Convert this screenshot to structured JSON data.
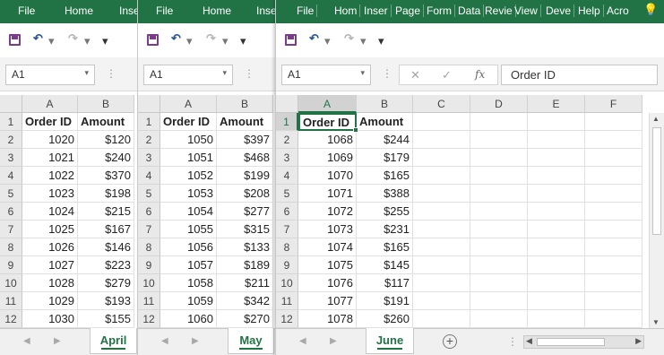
{
  "ribbon_common": [
    "File",
    "Home",
    "Inse"
  ],
  "ribbon_full": [
    "File",
    "Hom",
    "Inser",
    "Page",
    "Form",
    "Data",
    "Revie",
    "View",
    "Deve",
    "Help",
    "Acro"
  ],
  "icons": {
    "save": "save-icon",
    "undo": "undo-icon",
    "redo": "redo-icon",
    "customize": "customize-qat-icon",
    "lightbulb": "lightbulb-icon"
  },
  "accent_color": "#217346",
  "windows": [
    {
      "sheet_name": "April",
      "name_box": "A1",
      "headers": [
        "Order ID",
        "Amount"
      ],
      "rows": [
        [
          "1020",
          "$120"
        ],
        [
          "1021",
          "$240"
        ],
        [
          "1022",
          "$370"
        ],
        [
          "1023",
          "$198"
        ],
        [
          "1024",
          "$215"
        ],
        [
          "1025",
          "$167"
        ],
        [
          "1026",
          "$146"
        ],
        [
          "1027",
          "$223"
        ],
        [
          "1028",
          "$279"
        ],
        [
          "1029",
          "$193"
        ],
        [
          "1030",
          "$155"
        ]
      ]
    },
    {
      "sheet_name": "May",
      "name_box": "A1",
      "headers": [
        "Order ID",
        "Amount"
      ],
      "rows": [
        [
          "1050",
          "$397"
        ],
        [
          "1051",
          "$468"
        ],
        [
          "1052",
          "$199"
        ],
        [
          "1053",
          "$208"
        ],
        [
          "1054",
          "$277"
        ],
        [
          "1055",
          "$315"
        ],
        [
          "1056",
          "$133"
        ],
        [
          "1057",
          "$189"
        ],
        [
          "1058",
          "$211"
        ],
        [
          "1059",
          "$342"
        ],
        [
          "1060",
          "$270"
        ]
      ]
    },
    {
      "sheet_name": "June",
      "name_box": "A1",
      "formula": "Order ID",
      "headers": [
        "Order ID",
        "Amount"
      ],
      "rows": [
        [
          "1068",
          "$244"
        ],
        [
          "1069",
          "$179"
        ],
        [
          "1070",
          "$165"
        ],
        [
          "1071",
          "$388"
        ],
        [
          "1072",
          "$255"
        ],
        [
          "1073",
          "$231"
        ],
        [
          "1074",
          "$165"
        ],
        [
          "1075",
          "$145"
        ],
        [
          "1076",
          "$117"
        ],
        [
          "1077",
          "$191"
        ],
        [
          "1078",
          "$260"
        ]
      ]
    }
  ],
  "columns": [
    "A",
    "B",
    "C",
    "D",
    "E",
    "F"
  ],
  "row_numbers": [
    "1",
    "2",
    "3",
    "4",
    "5",
    "6",
    "7",
    "8",
    "9",
    "10",
    "11",
    "12"
  ],
  "glyphs": {
    "undo": "↶",
    "redo": "↷",
    "caret": "▾",
    "customize": "▾",
    "cancel": "✕",
    "enter": "✓",
    "fx": "fx",
    "dots": "⋮",
    "add_sheet": "+",
    "nav_prev": "◀",
    "nav_next": "▶",
    "scroll_up": "▲",
    "scroll_down": "▼",
    "lightbulb": "💡"
  }
}
